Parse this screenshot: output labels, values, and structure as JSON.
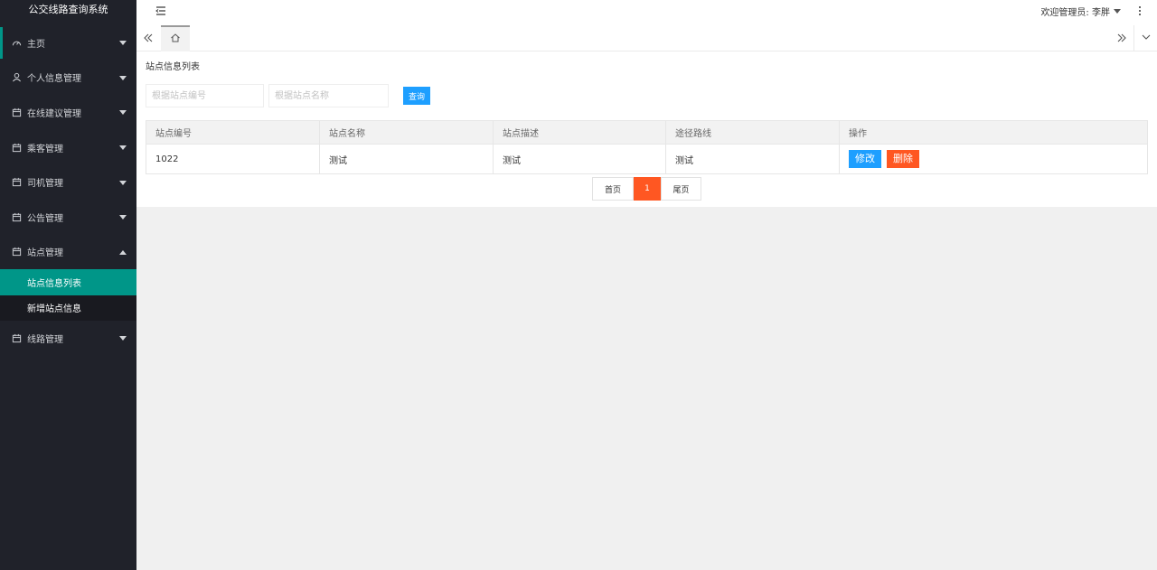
{
  "app": {
    "title": "公交线路查询系统"
  },
  "header": {
    "user_label": "欢迎管理员: 李胖"
  },
  "sidebar": {
    "items": [
      {
        "label": "主页",
        "icon": "dashboard-icon"
      },
      {
        "label": "个人信息管理",
        "icon": "user-icon"
      },
      {
        "label": "在线建议管理",
        "icon": "calendar-icon"
      },
      {
        "label": "乘客管理",
        "icon": "calendar-icon"
      },
      {
        "label": "司机管理",
        "icon": "calendar-icon"
      },
      {
        "label": "公告管理",
        "icon": "calendar-icon"
      },
      {
        "label": "站点管理",
        "icon": "calendar-icon",
        "expanded": true,
        "children": [
          {
            "label": "站点信息列表",
            "active": true
          },
          {
            "label": "新增站点信息"
          }
        ]
      },
      {
        "label": "线路管理",
        "icon": "calendar-icon"
      }
    ]
  },
  "main": {
    "title": "站点信息列表",
    "search": {
      "code_placeholder": "根据站点编号",
      "name_placeholder": "根据站点名称",
      "button_label": "查询"
    },
    "table": {
      "headers": [
        "站点编号",
        "站点名称",
        "站点描述",
        "途径路线",
        "操作"
      ],
      "rows": [
        {
          "code": "1022",
          "name": "测试",
          "desc": "测试",
          "route": "测试"
        }
      ],
      "edit_label": "修改",
      "delete_label": "删除"
    },
    "pager": {
      "first": "首页",
      "current": "1",
      "last": "尾页"
    }
  },
  "colors": {
    "sidebar_bg": "#20222a",
    "accent": "#009688",
    "primary": "#1e9fff",
    "danger": "#ff5722"
  }
}
